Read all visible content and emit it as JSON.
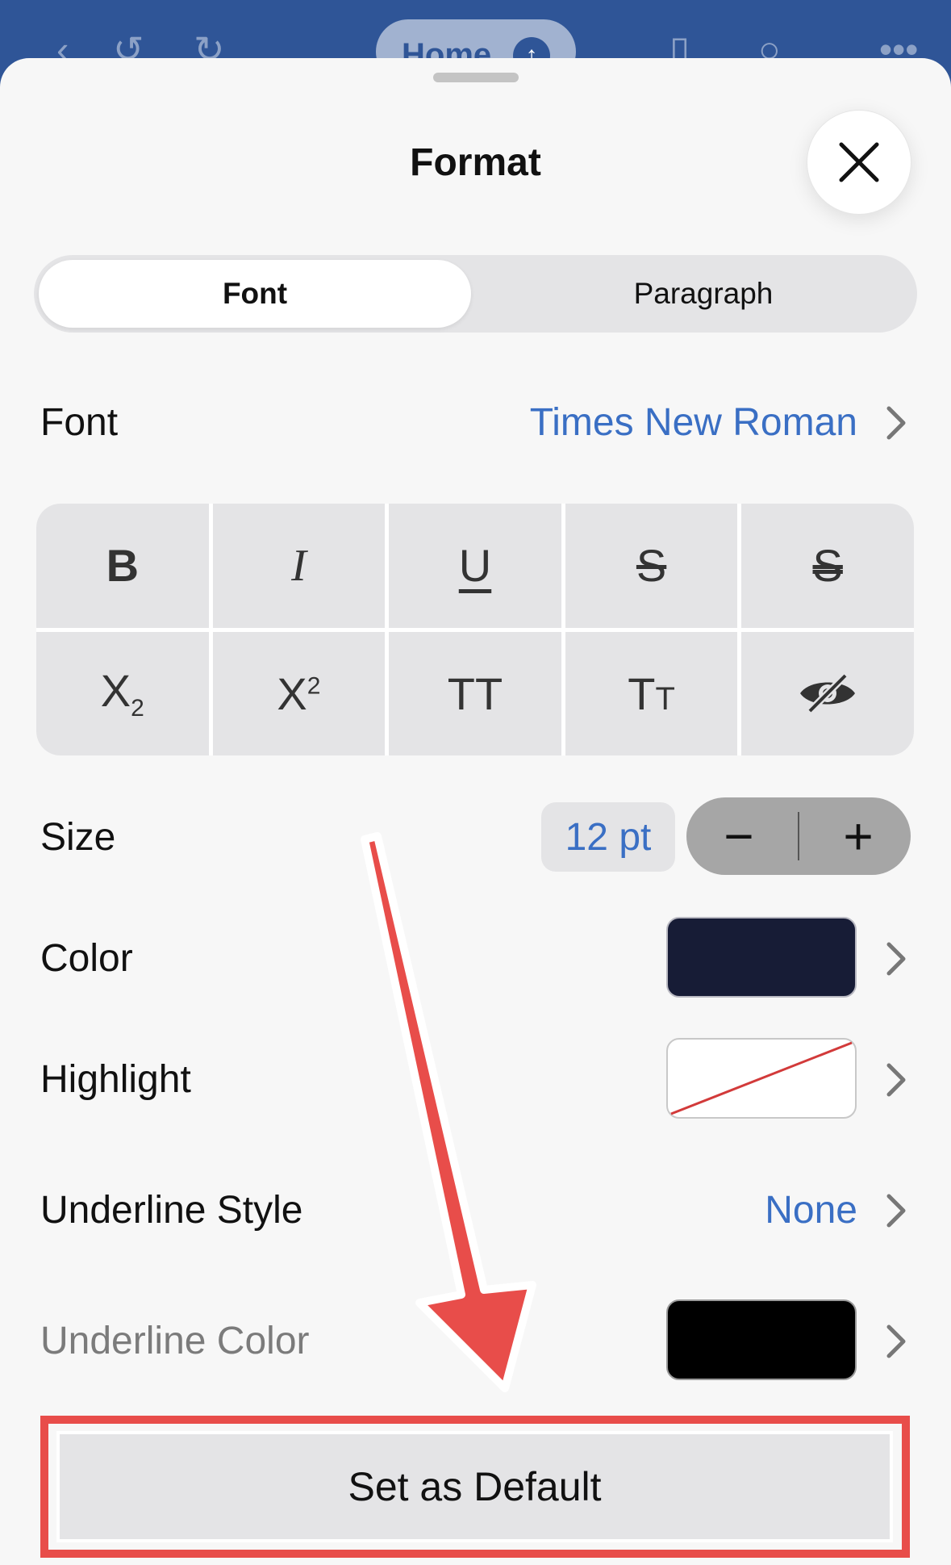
{
  "topbar": {
    "back_icon": "back-chevron-icon",
    "undo_icon": "undo-icon",
    "redo_icon": "redo-icon",
    "home_tab_label": "Home",
    "phone_icon": "phone-view-icon",
    "search_icon": "search-icon",
    "more_icon": "more-icon"
  },
  "sheet": {
    "title": "Format",
    "close_icon": "close-icon"
  },
  "tabs": [
    {
      "label": "Font",
      "active": true
    },
    {
      "label": "Paragraph",
      "active": false
    }
  ],
  "font_row": {
    "label": "Font",
    "value": "Times New Roman"
  },
  "style_buttons": {
    "bold": "B",
    "italic": "I",
    "underline": "U",
    "strikethrough": "S",
    "double_strikethrough": "S",
    "subscript_base": "X",
    "subscript_sub": "2",
    "superscript_base": "X",
    "superscript_sup": "2",
    "all_caps": "TT",
    "small_caps_big": "T",
    "small_caps_small": "T",
    "hidden_icon": "eye-slash-icon"
  },
  "size_row": {
    "label": "Size",
    "value": "12 pt",
    "decrement": "−",
    "increment": "+"
  },
  "color_row": {
    "label": "Color",
    "swatch_color": "#171c36"
  },
  "highlight_row": {
    "label": "Highlight",
    "swatch_color": "none"
  },
  "underline_style_row": {
    "label": "Underline Style",
    "value": "None"
  },
  "underline_color_row": {
    "label": "Underline Color",
    "swatch_color": "#000000"
  },
  "default_button": {
    "label": "Set as Default"
  },
  "colors": {
    "accent_blue": "#3a6fc4",
    "header_blue": "#2f5597",
    "annotation_red": "#e84d4a"
  }
}
